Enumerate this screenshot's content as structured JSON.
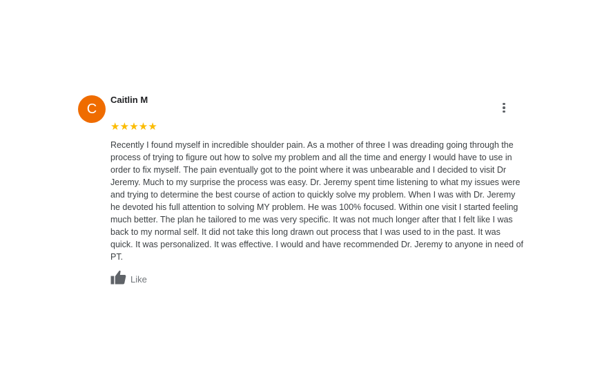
{
  "review": {
    "avatar_letter": "C",
    "author": "Caitlin M",
    "rating": 5,
    "rating_max": 5,
    "text": "Recently I found myself in incredible shoulder pain. As a mother of three I was dreading going through the process of trying to figure out how to solve my problem and all the time and energy I would have to use in order to fix myself. The pain eventually got to the point where it was unbearable and I decided to visit Dr Jeremy. Much to my surprise the process was easy. Dr. Jeremy spent time listening to what my issues were and trying to determine the best course of action to quickly solve my problem. When I was with Dr. Jeremy he devoted his full attention to solving MY problem. He was 100% focused. Within one visit I started feeling much better. The plan he tailored to me was very specific. It was not much longer after that I felt like I was back to my normal self. It did not take this long drawn out process that I was used to in the past. It was quick. It was personalized. It was effective. I would and have recommended Dr. Jeremy to anyone in need of PT.",
    "like_label": "Like"
  },
  "colors": {
    "avatar_bg": "#ef6c00",
    "star": "#fbbc04",
    "icon_gray": "#5f6368"
  },
  "icons": {
    "more": "more-vert-icon",
    "star": "star-icon",
    "like": "thumbs-up-icon"
  }
}
